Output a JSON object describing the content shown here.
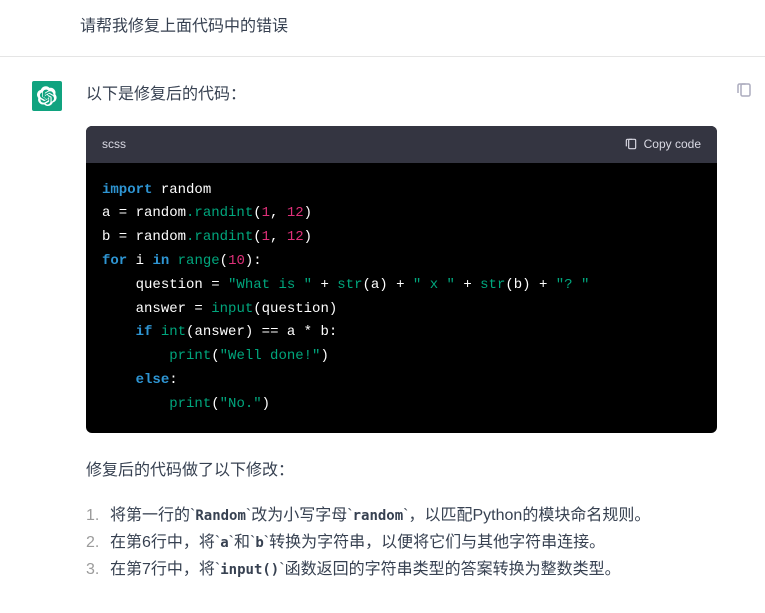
{
  "user_message": "请帮我修复上面代码中的错误",
  "assistant_intro": "以下是修复后的代码：",
  "code_lang": "scss",
  "copy_label": "Copy code",
  "code": {
    "l1": {
      "kw1": "import",
      "id1": "random"
    },
    "l2": {
      "id1": "a = random",
      "fn1": ".randint",
      "p1": "(",
      "n1": "1",
      "c1": ", ",
      "n2": "12",
      "p2": ")"
    },
    "l3": {
      "id1": "b = random",
      "fn1": ".randint",
      "p1": "(",
      "n1": "1",
      "c1": ", ",
      "n2": "12",
      "p2": ")"
    },
    "l4": {
      "kw1": "for",
      "id1": " i ",
      "kw2": "in",
      "sp": " ",
      "fn1": "range",
      "p1": "(",
      "n1": "10",
      "p2": "):"
    },
    "l5": {
      "indent": "    ",
      "id1": "question = ",
      "s1": "\"What is \"",
      "op1": " + ",
      "fn1": "str",
      "p1": "(a) ",
      "op2": "+ ",
      "s2": "\" x \"",
      "op3": " + ",
      "fn2": "str",
      "p2": "(b) ",
      "op4": "+ ",
      "s3": "\"? \""
    },
    "l6": {
      "indent": "    ",
      "id1": "answer = ",
      "fn1": "input",
      "p1": "(question)"
    },
    "l7": {
      "indent": "    ",
      "kw1": "if",
      "sp": " ",
      "fn1": "int",
      "p1": "(answer) ",
      "op1": "== a * b:"
    },
    "l8": {
      "indent": "        ",
      "fn1": "print",
      "p1": "(",
      "s1": "\"Well done!\"",
      "p2": ")"
    },
    "l9": {
      "indent": "    ",
      "kw1": "else",
      "p1": ":"
    },
    "l10": {
      "indent": "        ",
      "fn1": "print",
      "p1": "(",
      "s1": "\"No.\"",
      "p2": ")"
    }
  },
  "explain_header": "修复后的代码做了以下修改：",
  "fixes": [
    {
      "pre": "将第一行的`",
      "c1": "Random",
      "mid": "`改为小写字母`",
      "c2": "random",
      "post": "`，以匹配Python的模块命名规则。"
    },
    {
      "pre": "在第6行中，将`",
      "c1": "a",
      "mid": "`和`",
      "c2": "b",
      "post": "`转换为字符串，以便将它们与其他字符串连接。"
    },
    {
      "pre": "在第7行中，将`",
      "c1": "input()",
      "mid": "",
      "c2": "",
      "post": "`函数返回的字符串类型的答案转换为整数类型。"
    }
  ]
}
